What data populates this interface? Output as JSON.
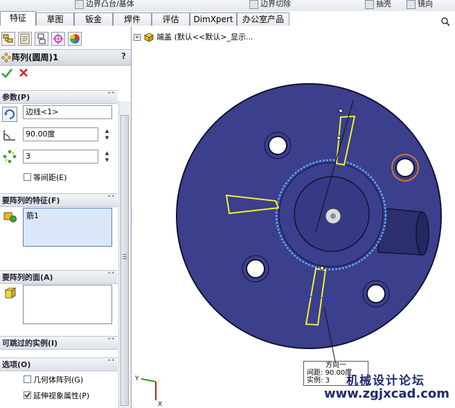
{
  "colors": {
    "part_face": "#3b3f8c",
    "part_edge": "#101230",
    "highlight_yellow": "#f4ef2a",
    "highlight_blue": "#5aa8ff",
    "hole_highlight": "#e0782f"
  },
  "top_strip": {
    "items": [
      "边界凸台/基体",
      "边界切除",
      "抽壳",
      "镜向"
    ]
  },
  "tabs": [
    "特征",
    "草图",
    "钣金",
    "焊件",
    "评估",
    "DimXpert",
    "办公室产品"
  ],
  "active_tab": "特征",
  "property_manager": {
    "title": "阵列(圆周)1",
    "help_label": "?",
    "sections": {
      "parameters": {
        "label": "参数(P)",
        "axis_value": "边线<1>",
        "angle_value": "90.00度",
        "instances_value": "3",
        "equal_spacing_label": "等间距(E)",
        "equal_spacing_checked": false
      },
      "features_to_pattern": {
        "label": "要阵列的特征(F)",
        "items": [
          "筋1"
        ]
      },
      "faces_to_pattern": {
        "label": "要阵列的面(A)"
      },
      "instances_to_skip": {
        "label": "可跳过的实例(I)"
      },
      "options": {
        "label": "选项(O)",
        "geometry_pattern_label": "几何体阵列(G)",
        "geometry_pattern_checked": false,
        "propagate_visual_label": "延伸视象属性(P)",
        "propagate_visual_checked": true
      }
    }
  },
  "feature_tree": {
    "root_label": "端盖  (默认<<默认>_显示..."
  },
  "callout": {
    "title": "方向一",
    "spacing_label": "间距:",
    "spacing_value": "90.00度",
    "instances_label": "实例:",
    "instances_value": "3"
  },
  "triad": {
    "x": "X",
    "y": "Y"
  },
  "watermark": {
    "chinese": "机械设计论坛",
    "url": "www.zgjxcad.com"
  }
}
